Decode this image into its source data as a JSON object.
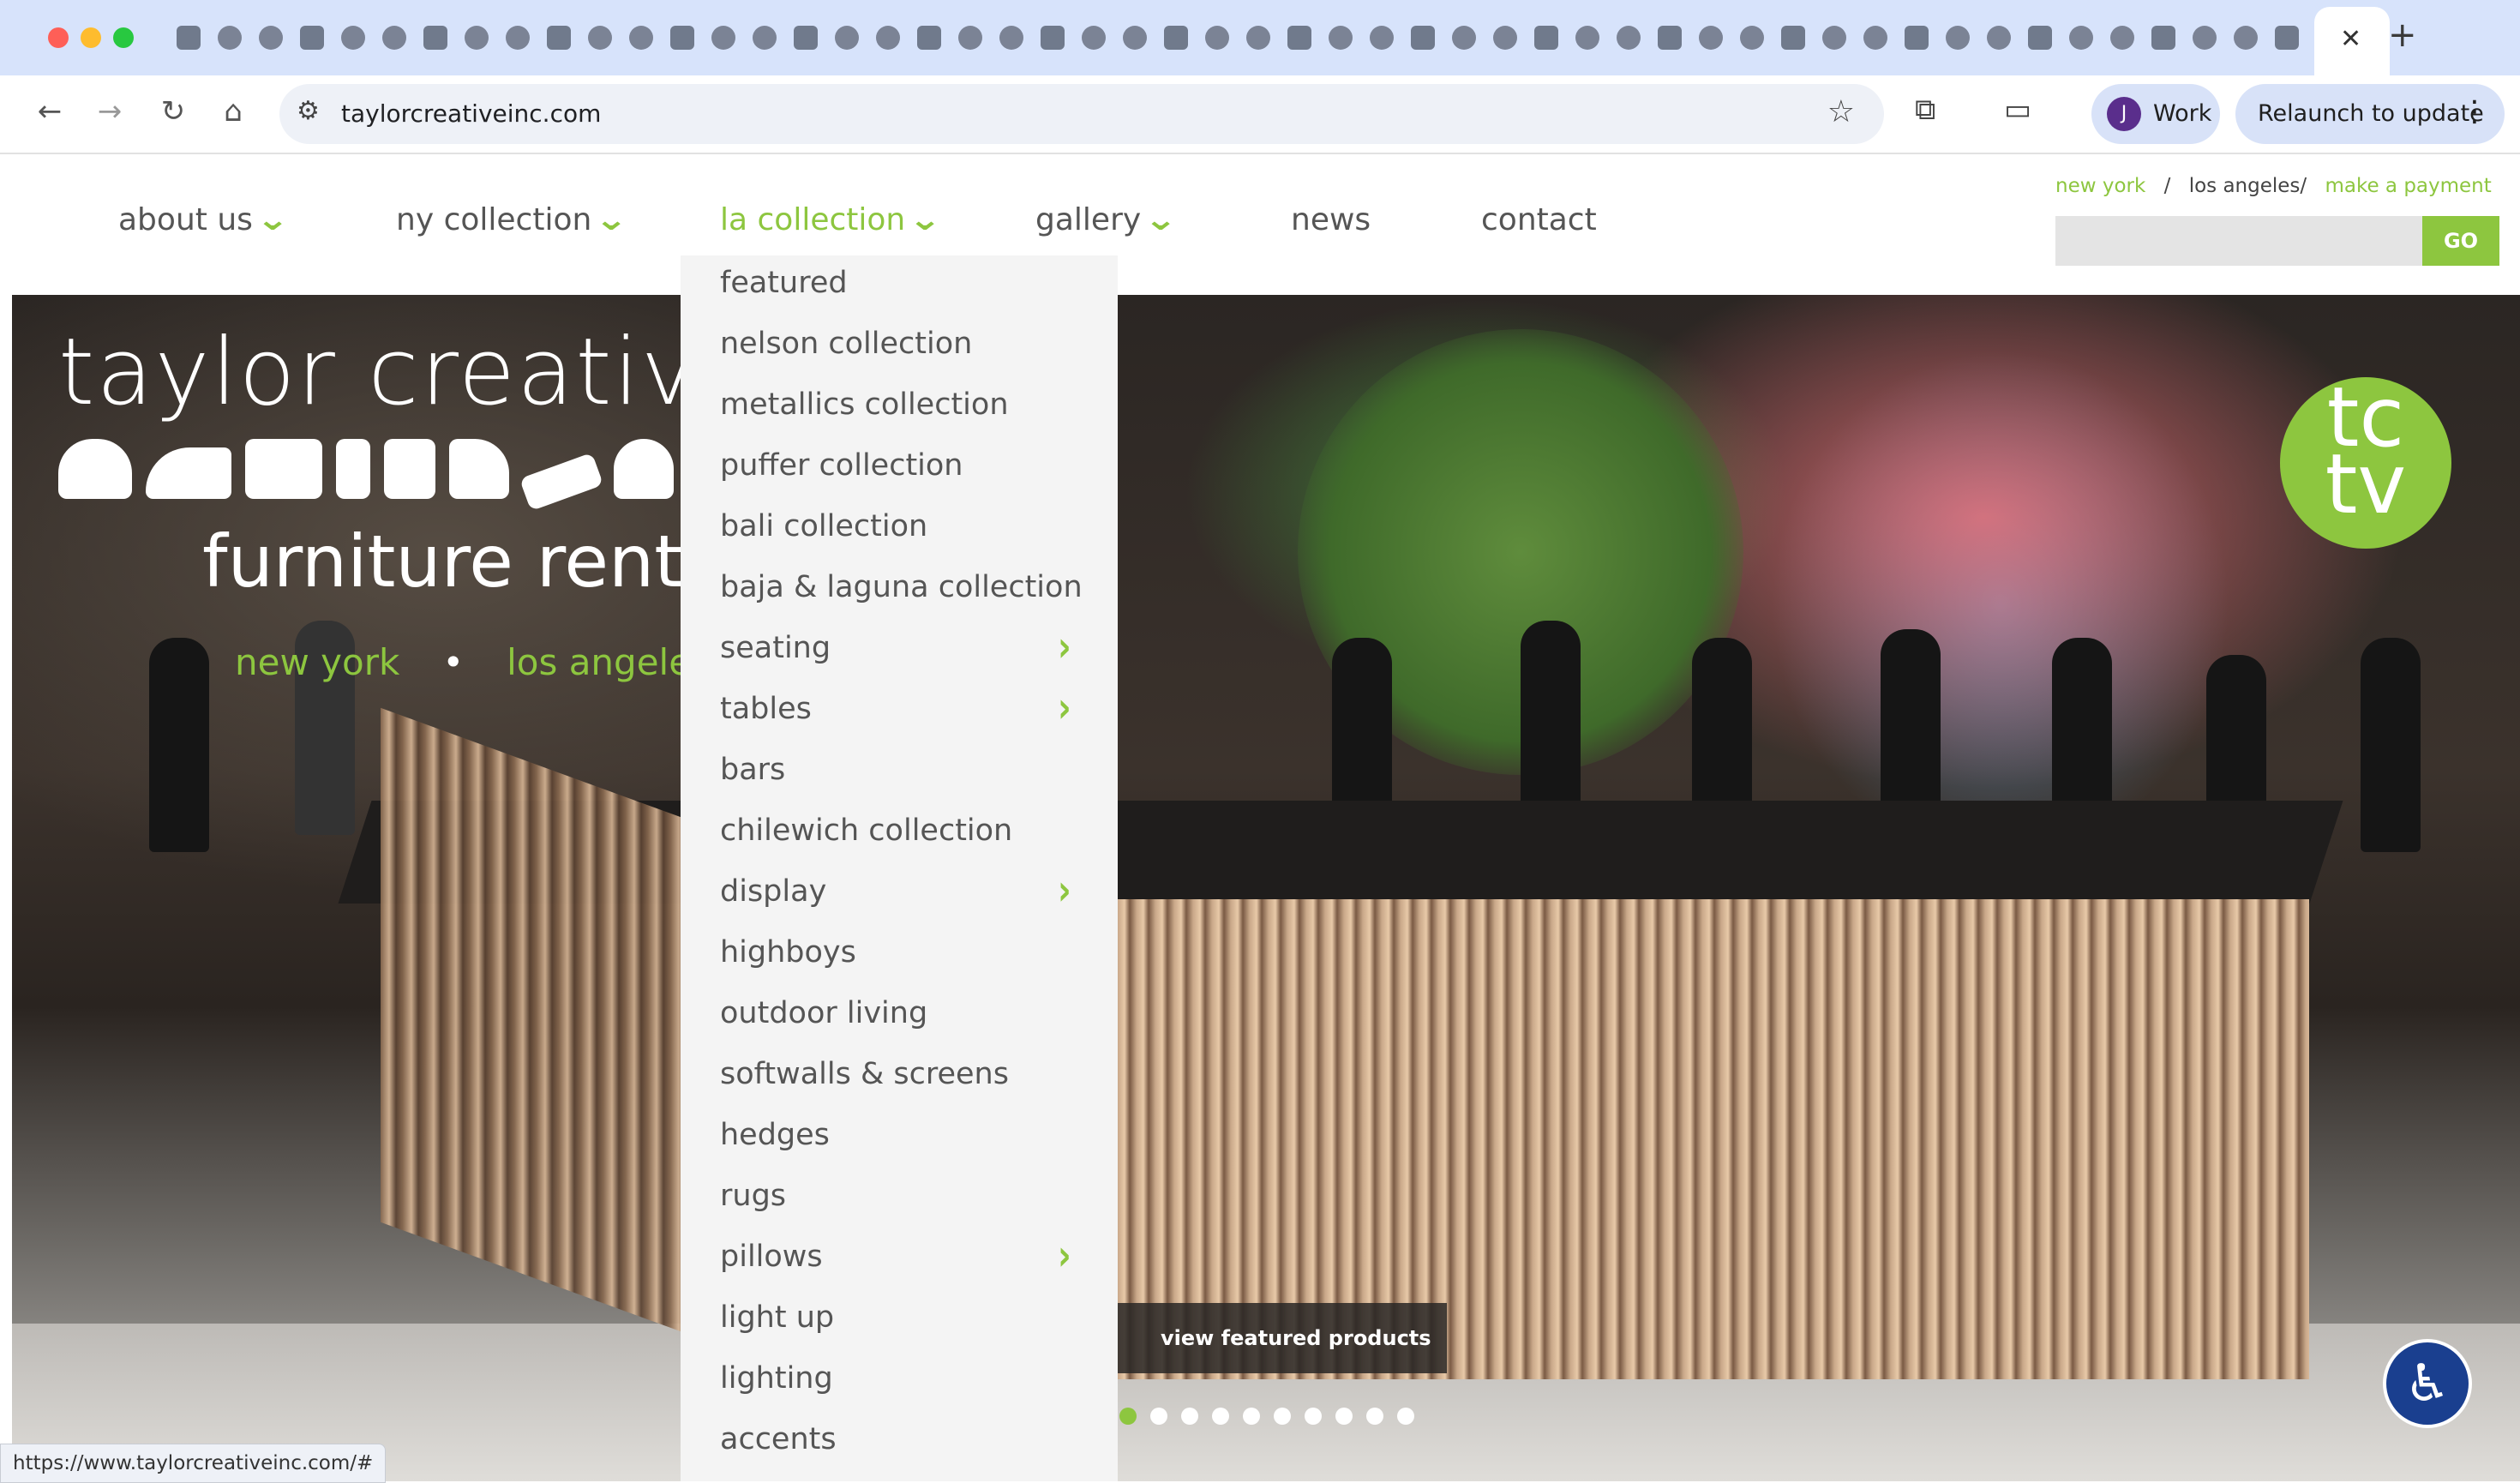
{
  "browser": {
    "url": "taylorcreativeinc.com",
    "profile_initial": "J",
    "profile_name": "Work",
    "relaunch_label": "Relaunch to update",
    "status_url": "https://www.taylorcreativeinc.com/#"
  },
  "header": {
    "nav": [
      {
        "label": "about us",
        "has_dropdown": true
      },
      {
        "label": "ny collection",
        "has_dropdown": true
      },
      {
        "label": "la collection",
        "has_dropdown": true,
        "active": true
      },
      {
        "label": "gallery",
        "has_dropdown": true
      },
      {
        "label": "news",
        "has_dropdown": false
      },
      {
        "label": "contact",
        "has_dropdown": false
      }
    ],
    "top_links": {
      "new_york": "new york",
      "sep": "/",
      "los_angeles": "los angeles/",
      "payment": "make a payment"
    },
    "search_placeholder": "",
    "go_label": "GO"
  },
  "dropdown": {
    "items": [
      {
        "label": "featured",
        "submenu": false
      },
      {
        "label": "nelson collection",
        "submenu": false
      },
      {
        "label": "metallics collection",
        "submenu": false
      },
      {
        "label": "puffer collection",
        "submenu": false
      },
      {
        "label": "bali collection",
        "submenu": false
      },
      {
        "label": "baja & laguna collection",
        "submenu": false
      },
      {
        "label": "seating",
        "submenu": true
      },
      {
        "label": "tables",
        "submenu": true
      },
      {
        "label": "bars",
        "submenu": false
      },
      {
        "label": "chilewich collection",
        "submenu": false
      },
      {
        "label": "display",
        "submenu": true
      },
      {
        "label": "highboys",
        "submenu": false
      },
      {
        "label": "outdoor living",
        "submenu": false
      },
      {
        "label": "softwalls & screens",
        "submenu": false
      },
      {
        "label": "hedges",
        "submenu": false
      },
      {
        "label": "rugs",
        "submenu": false
      },
      {
        "label": "pillows",
        "submenu": true
      },
      {
        "label": "light up",
        "submenu": false
      },
      {
        "label": "lighting",
        "submenu": false
      },
      {
        "label": "accents",
        "submenu": false
      }
    ]
  },
  "hero": {
    "logo_title": "taylor creative",
    "logo_sub": "furniture rental",
    "city_ny": "new york",
    "city_dot": "•",
    "city_la": "los angeles",
    "badge_line1": "tc",
    "badge_line2": "tv",
    "cta_label": "view featured products",
    "slide_count": 10,
    "active_slide": 1
  },
  "colors": {
    "accent": "#8dc63f",
    "nav_text": "#555555",
    "a11y_button": "#1a3f8f"
  }
}
